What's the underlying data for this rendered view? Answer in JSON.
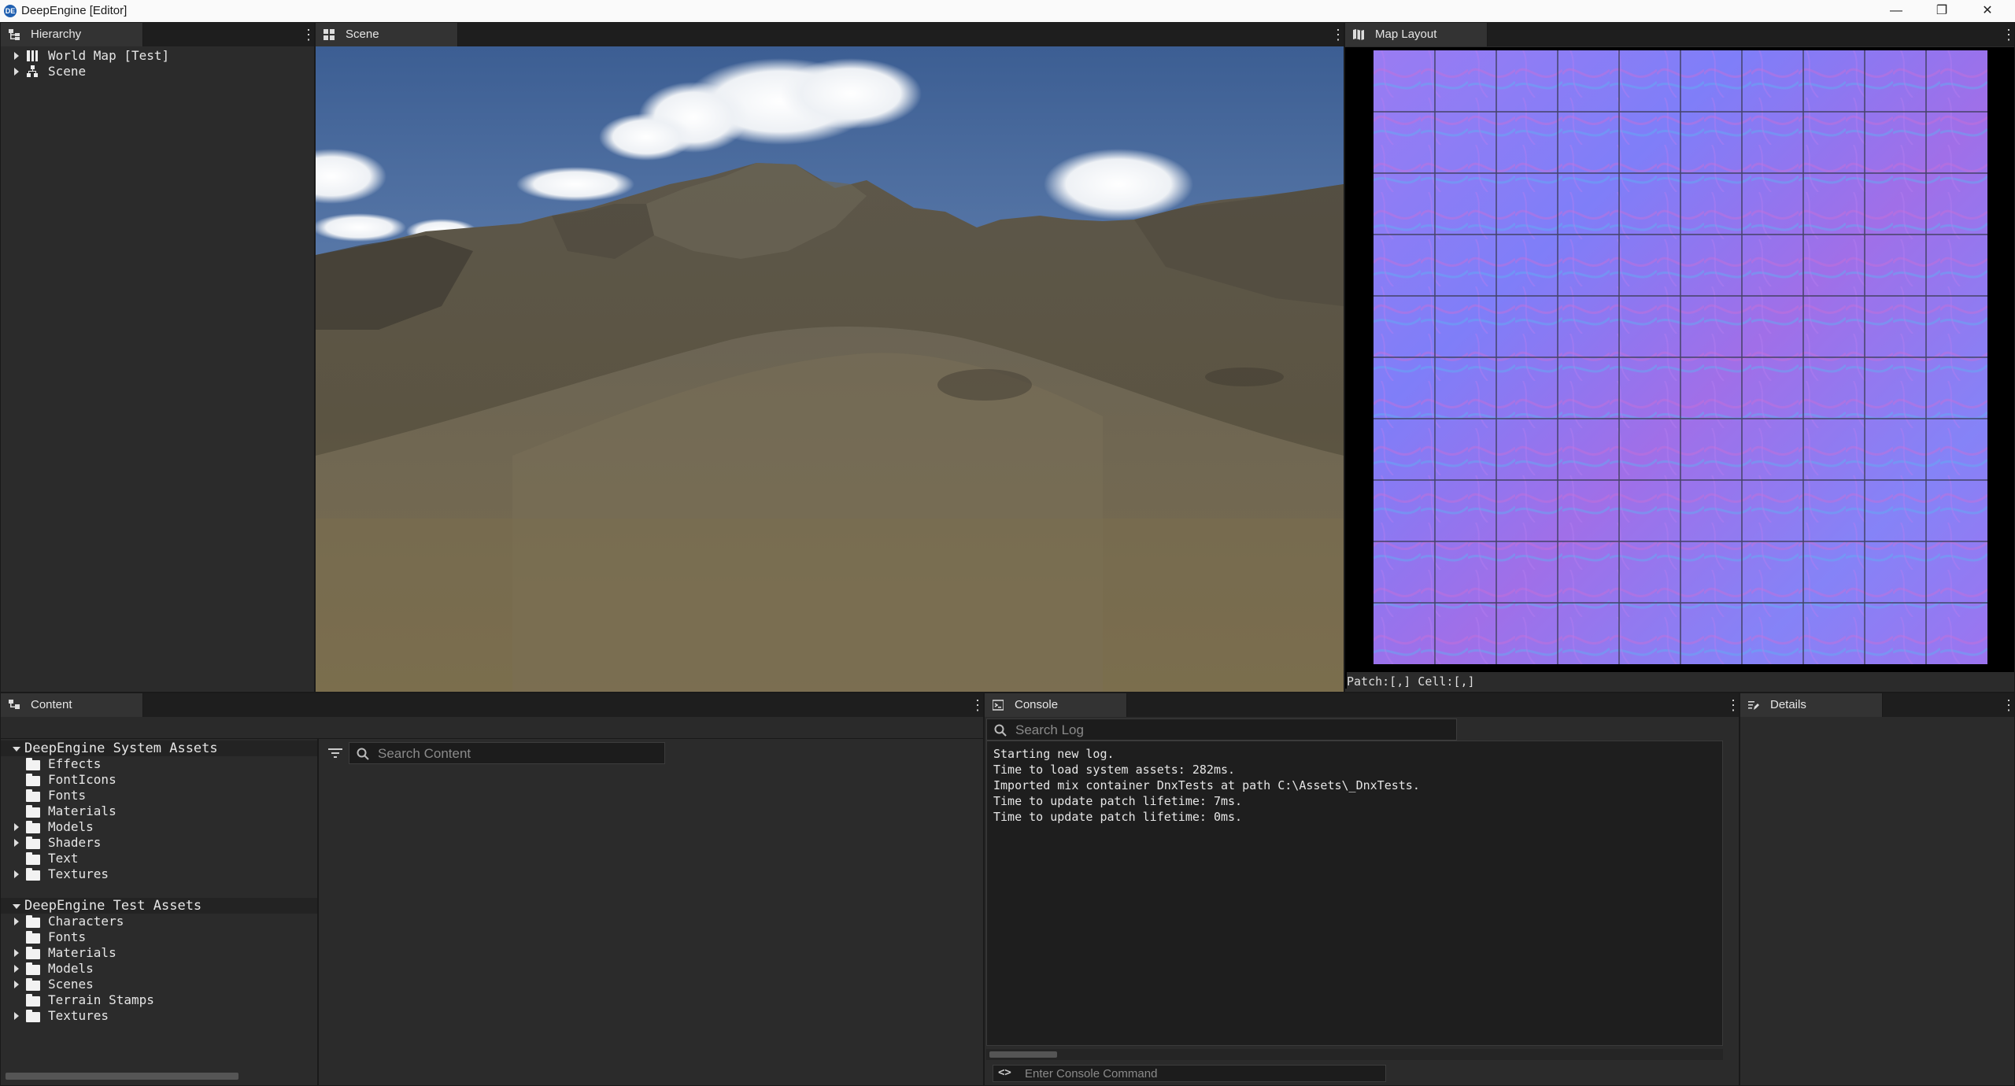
{
  "window": {
    "title": "DeepEngine [Editor]",
    "app_icon_text": "DE"
  },
  "hierarchy": {
    "tab_label": "Hierarchy",
    "items": [
      {
        "label": "World Map [Test]",
        "icon": "map-icon"
      },
      {
        "label": "Scene",
        "icon": "scene-nodes-icon"
      }
    ]
  },
  "scene": {
    "tab_label": "Scene"
  },
  "map_layout": {
    "tab_label": "Map Layout",
    "status": "Patch:[,] Cell:[,]"
  },
  "content": {
    "tab_label": "Content",
    "search_placeholder": "Search Content",
    "groups": [
      {
        "label": "DeepEngine System Assets",
        "items": [
          {
            "label": "Effects",
            "expandable": false
          },
          {
            "label": "FontIcons",
            "expandable": false
          },
          {
            "label": "Fonts",
            "expandable": false
          },
          {
            "label": "Materials",
            "expandable": false
          },
          {
            "label": "Models",
            "expandable": true
          },
          {
            "label": "Shaders",
            "expandable": true
          },
          {
            "label": "Text",
            "expandable": false
          },
          {
            "label": "Textures",
            "expandable": true
          }
        ]
      },
      {
        "label": "DeepEngine Test Assets",
        "items": [
          {
            "label": "Characters",
            "expandable": true
          },
          {
            "label": "Fonts",
            "expandable": false
          },
          {
            "label": "Materials",
            "expandable": true
          },
          {
            "label": "Models",
            "expandable": true
          },
          {
            "label": "Scenes",
            "expandable": true
          },
          {
            "label": "Terrain Stamps",
            "expandable": false
          },
          {
            "label": "Textures",
            "expandable": true
          }
        ]
      }
    ]
  },
  "console": {
    "tab_label": "Console",
    "search_placeholder": "Search Log",
    "lines": [
      "Starting new log.",
      "Time to load system assets: 282ms.",
      "Imported mix container DnxTests at path C:\\Assets\\_DnxTests.",
      "Time to update patch lifetime: 7ms.",
      "Time to update patch lifetime: 0ms."
    ],
    "command_placeholder": "Enter Console Command",
    "command_icon": "<>"
  },
  "details": {
    "tab_label": "Details"
  },
  "colors": {
    "panel_bg": "#2b2b2b",
    "tab_bg": "#333333",
    "accent_titlebar": "#fafafa",
    "normal_map_base": "#8f6ff5"
  }
}
